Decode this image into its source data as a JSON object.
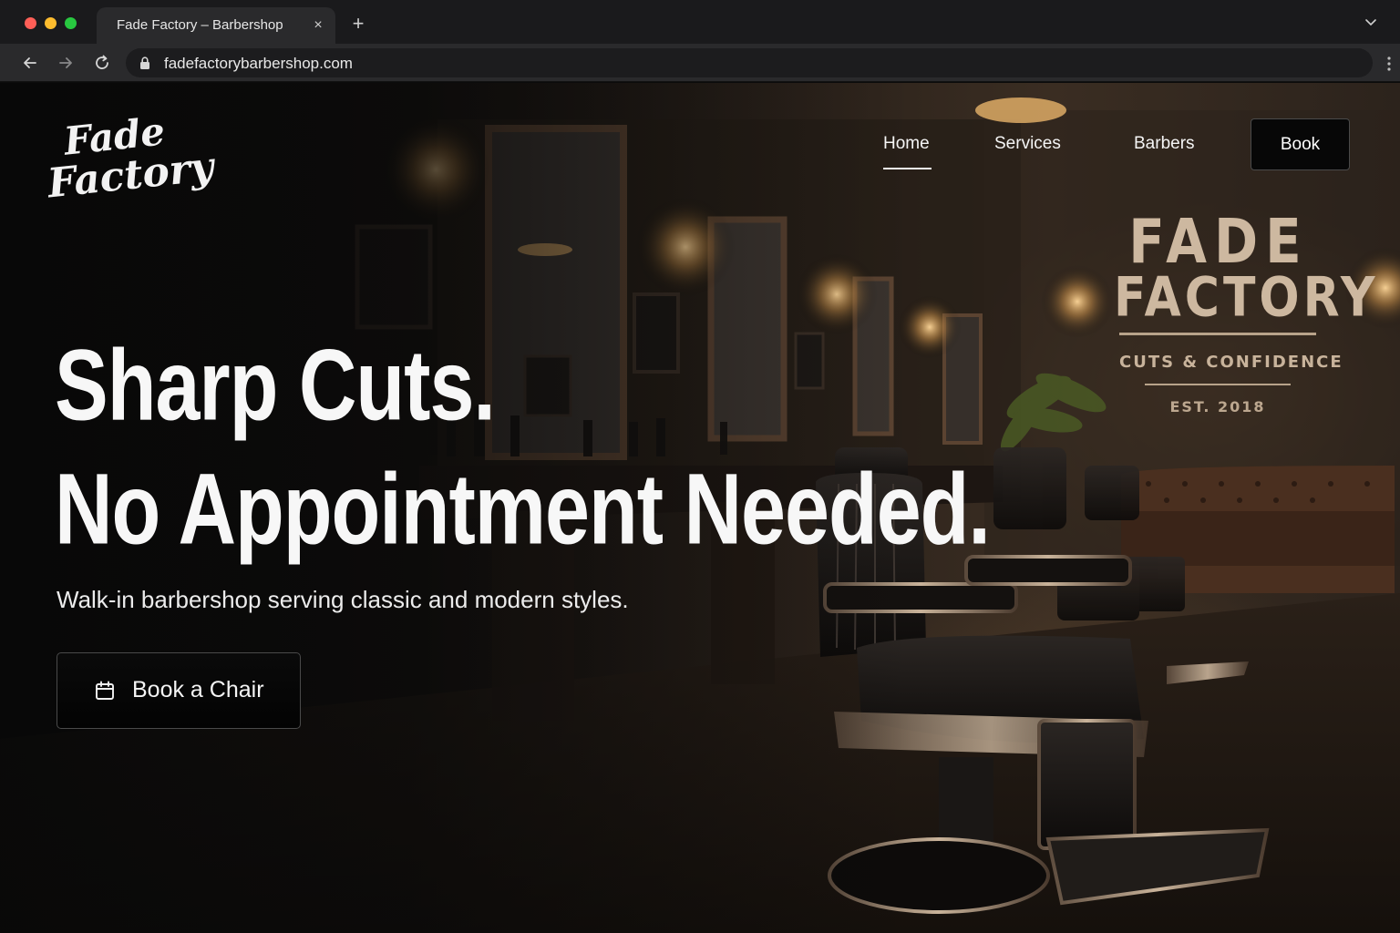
{
  "browser": {
    "tab_title": "Fade Factory – Barbershop",
    "tab_close": "×",
    "new_tab": "+",
    "url": "fadefactorybarbershop.com"
  },
  "site": {
    "logo": {
      "line1": "Fade",
      "line2": "Factory"
    },
    "nav": {
      "home": "Home",
      "services": "Services",
      "barbers": "Barbers",
      "book": "Book",
      "active": "Home"
    },
    "wall_sign": {
      "line1": "FADE",
      "line2": "FACTORY",
      "tagline": "CUTS & CONFIDENCE",
      "established": "EST. 2018"
    },
    "hero": {
      "headline_line1": "Sharp Cuts.",
      "headline_line2": "No Appointment Needed.",
      "subtitle": "Walk-in barbershop serving classic and modern styles.",
      "cta_label": "Book a Chair",
      "cta_icon": "calendar-icon"
    }
  },
  "colors": {
    "page_background": "#0b0b0b",
    "accent_text": "#f7f7f7",
    "sign_text": "#cdb8a0",
    "chrome": "#2a2a2c"
  }
}
